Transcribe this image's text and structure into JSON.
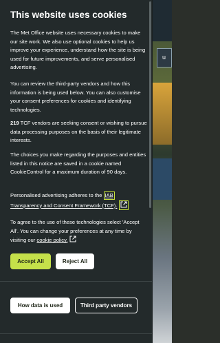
{
  "dialog": {
    "title": "This website uses cookies",
    "p1": "The Met Office website uses necessary cookies to make our site work. We also use optional cookies to help us improve your experience, understand how the site is being used for future improvements, and serve personalised advertising.",
    "p2": "You can review the third-party vendors and how this information is being used below. You can also customise your consent preferences for cookies and identifying technologies.",
    "p3_count": "219",
    "p3_rest": " TCF vendors are seeking consent or wishing to pursue data processing purposes on the basis of their legitimate interests.",
    "p4": "The choices you make regarding the purposes and entities listed in this notice are saved in a cookie named CookieControl for a maximum duration of 90 days.",
    "p5_prefix": "Personalised advertising adheres to the ",
    "p5_link_a": "IAB",
    "p5_link_b": "Transparency and Consent Framework (TCF).",
    "p6_prefix": "To agree to the use of these technologies select 'Accept All'. You can change your preferences at any time by visiting our ",
    "p6_link": "cookie policy.",
    "accept_label": "Accept All",
    "reject_label": "Reject All",
    "data_label": "How data is used",
    "vendors_label": "Third party vendors"
  },
  "background": {
    "button_glyph": "u"
  },
  "colors": {
    "panel": "#232a2b",
    "accent": "#c5e04a",
    "focus": "#c9e33a"
  }
}
